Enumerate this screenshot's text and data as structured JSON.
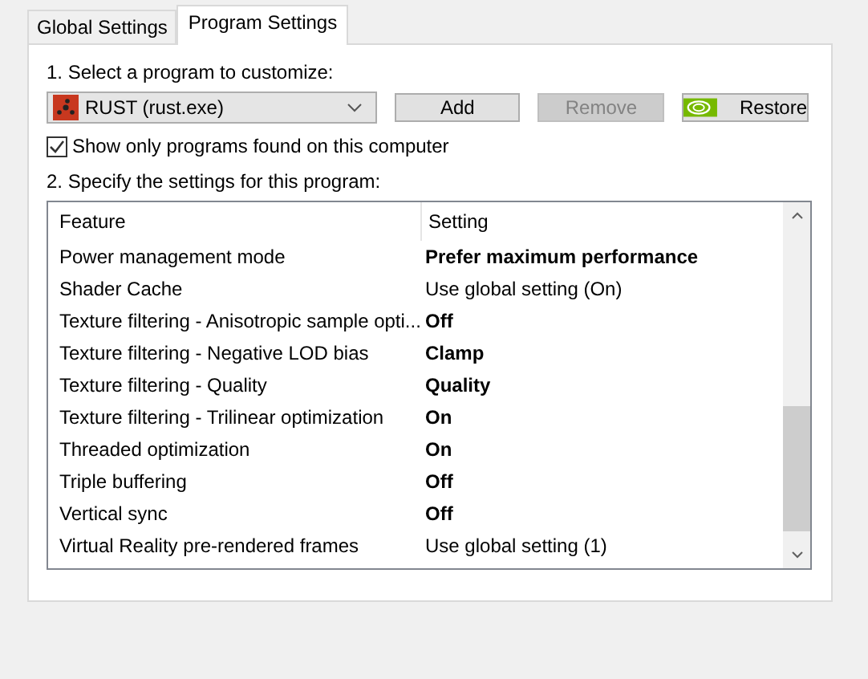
{
  "tabs": [
    {
      "label": "Global Settings",
      "selected": false
    },
    {
      "label": "Program Settings",
      "selected": true
    }
  ],
  "step1_label": "1. Select a program to customize:",
  "program_dropdown": {
    "value": "RUST (rust.exe)"
  },
  "buttons": [
    {
      "label": "Add",
      "disabled": false,
      "kind": "plain"
    },
    {
      "label": "Remove",
      "disabled": true,
      "kind": "plain"
    },
    {
      "label": "Restore",
      "disabled": false,
      "kind": "logo"
    }
  ],
  "show_only_found": {
    "label": "Show only programs found on this computer",
    "checked": true
  },
  "step2_label": "2. Specify the settings for this program:",
  "table": {
    "columns": [
      "Feature",
      "Setting"
    ],
    "rows": [
      {
        "feature": "Power management mode",
        "setting": "Prefer maximum performance",
        "overridden": true
      },
      {
        "feature": "Shader Cache",
        "setting": "Use global setting (On)",
        "overridden": false
      },
      {
        "feature": "Texture filtering - Anisotropic sample opti...",
        "setting": "Off",
        "overridden": true
      },
      {
        "feature": "Texture filtering - Negative LOD bias",
        "setting": "Clamp",
        "overridden": true
      },
      {
        "feature": "Texture filtering - Quality",
        "setting": "Quality",
        "overridden": true
      },
      {
        "feature": "Texture filtering - Trilinear optimization",
        "setting": "On",
        "overridden": true
      },
      {
        "feature": "Threaded optimization",
        "setting": "On",
        "overridden": true
      },
      {
        "feature": "Triple buffering",
        "setting": "Off",
        "overridden": true
      },
      {
        "feature": "Vertical sync",
        "setting": "Off",
        "overridden": true
      },
      {
        "feature": "Virtual Reality pre-rendered frames",
        "setting": "Use global setting (1)",
        "overridden": false
      }
    ]
  }
}
